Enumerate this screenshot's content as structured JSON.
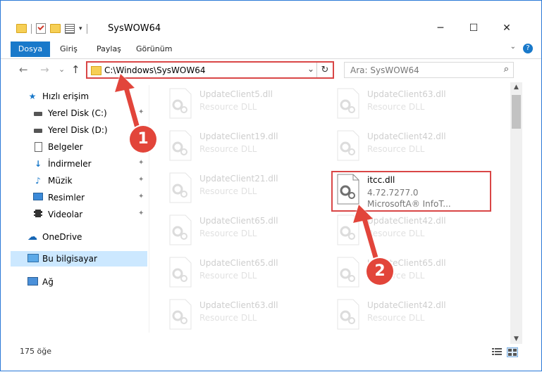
{
  "window": {
    "title": "SysWOW64",
    "minimize": "─",
    "maximize": "☐",
    "close": "✕"
  },
  "ribbon": {
    "tabs": [
      "Dosya",
      "Giriş",
      "Paylaş",
      "Görünüm"
    ],
    "help": "?",
    "expand": "⌄"
  },
  "address": {
    "back": "←",
    "forward": "→",
    "recent": "⌄",
    "up": "↑",
    "path": "C:\\Windows\\SysWOW64",
    "dropdown": "⌄",
    "refresh": "↻"
  },
  "search": {
    "placeholder": "Ara: SysWOW64",
    "icon": "⌕"
  },
  "nav": {
    "items": [
      {
        "label": "Hızlı erişim",
        "icon": "star-icon",
        "pinned": false
      },
      {
        "label": "Yerel Disk (C:)",
        "icon": "drive-icon",
        "pinned": true
      },
      {
        "label": "Yerel Disk (D:)",
        "icon": "drive-icon",
        "pinned": true
      },
      {
        "label": "Belgeler",
        "icon": "documents-icon",
        "pinned": true
      },
      {
        "label": "İndirmeler",
        "icon": "download-icon",
        "pinned": true
      },
      {
        "label": "Müzik",
        "icon": "music-icon",
        "pinned": true
      },
      {
        "label": "Resimler",
        "icon": "pictures-icon",
        "pinned": true
      },
      {
        "label": "Videolar",
        "icon": "videos-icon",
        "pinned": true
      },
      {
        "label": "OneDrive",
        "icon": "cloud-icon",
        "pinned": false
      },
      {
        "label": "Bu bilgisayar",
        "icon": "computer-icon",
        "pinned": false,
        "selected": true
      },
      {
        "label": "Ağ",
        "icon": "network-icon",
        "pinned": false
      }
    ],
    "pin_glyph": "📌"
  },
  "files": {
    "left": [
      {
        "name": "UpdateClient5.dll",
        "desc": "Resource DLL"
      },
      {
        "name": "UpdateClient19.dll",
        "desc": "Resource DLL"
      },
      {
        "name": "UpdateClient21.dll",
        "desc": "Resource DLL"
      },
      {
        "name": "UpdateClient65.dll",
        "desc": "Resource DLL"
      },
      {
        "name": "UpdateClient65.dll",
        "desc": "Resource DLL"
      },
      {
        "name": "UpdateClient63.dll",
        "desc": "Resource DLL"
      }
    ],
    "right": [
      {
        "name": "UpdateClient63.dll",
        "desc": "Resource DLL"
      },
      {
        "name": "UpdateClient42.dll",
        "desc": "Resource DLL"
      },
      {
        "name": "itcc.dll",
        "desc": "4.72.7277.0",
        "desc2": "MicrosoftA® InfoT...",
        "highlighted": true
      },
      {
        "name": "UpdateClient42.dll",
        "desc": "Resource DLL"
      },
      {
        "name": "UpdateClient65.dll",
        "desc": "Resource DLL"
      },
      {
        "name": "UpdateClient42.dll",
        "desc": "Resource DLL"
      }
    ]
  },
  "status": {
    "count": "175 öğe"
  },
  "callouts": {
    "step1": "1",
    "step2": "2",
    "color": "#e2453a"
  }
}
